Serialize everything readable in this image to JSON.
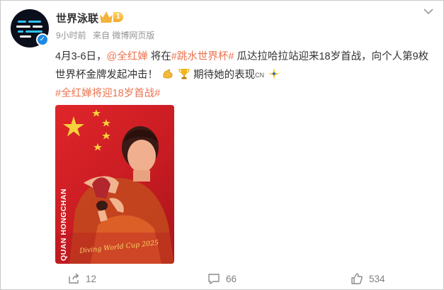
{
  "post": {
    "author": "世界泳联",
    "vip_level": "1",
    "time": "9小时前",
    "source": "来自 微博网页版",
    "text_prefix": "4月3-6日，",
    "mention": "@全红婵",
    "text_mid": " 将在",
    "topic_cup": "#跳水世界杯#",
    "text_after_topic": " 瓜达拉哈拉站迎来18岁首战，向个人第9枚世界杯金牌发起冲击！",
    "text_expect": " 期待她的表现",
    "cn_flag": "CN",
    "topic_bottom": "#全红婵将迎18岁首战#",
    "image": {
      "vertical_name": "QUAN HONGCHAN",
      "signature": "Diving World Cup 2025",
      "colors": {
        "background": "#d8222a",
        "star": "#f7d13a"
      }
    },
    "actions": {
      "share_count": "12",
      "comment_count": "66",
      "like_count": "534"
    }
  },
  "colors": {
    "link": "#eb7350",
    "meta": "#939393",
    "verified": "#1e88e5"
  },
  "icons": [
    "avatar-logo",
    "verified-icon",
    "vip-crown-icon",
    "chevron-down-icon",
    "flexed-biceps-icon",
    "trophy-icon",
    "sparkle-icon",
    "share-icon",
    "comment-icon",
    "like-icon"
  ]
}
